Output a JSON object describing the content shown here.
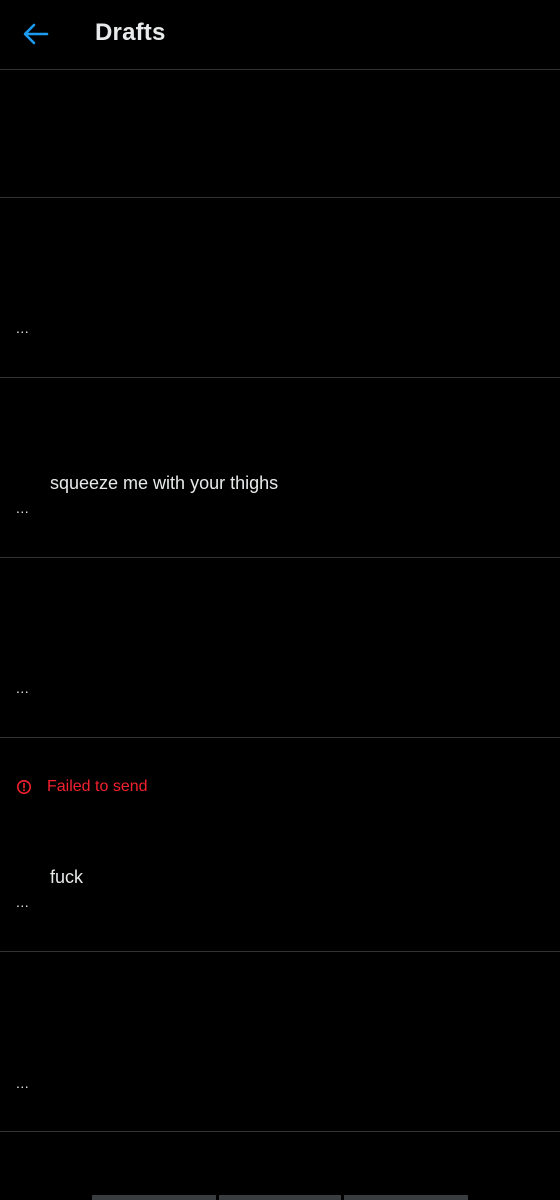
{
  "header": {
    "title": "Drafts",
    "back_icon": "arrow-left-icon",
    "accent_color": "#1d9bf0"
  },
  "drafts": [
    {
      "text": "",
      "more": ""
    },
    {
      "text": "",
      "more": "..."
    },
    {
      "text": "squeeze me with your thighs",
      "more": "..."
    },
    {
      "text": "",
      "more": "..."
    },
    {
      "text": "fuck",
      "more": "...",
      "status": "Failed to send",
      "status_color": "#f4212e",
      "status_icon": "alert-circle-icon"
    },
    {
      "text": "",
      "more": "..."
    }
  ]
}
